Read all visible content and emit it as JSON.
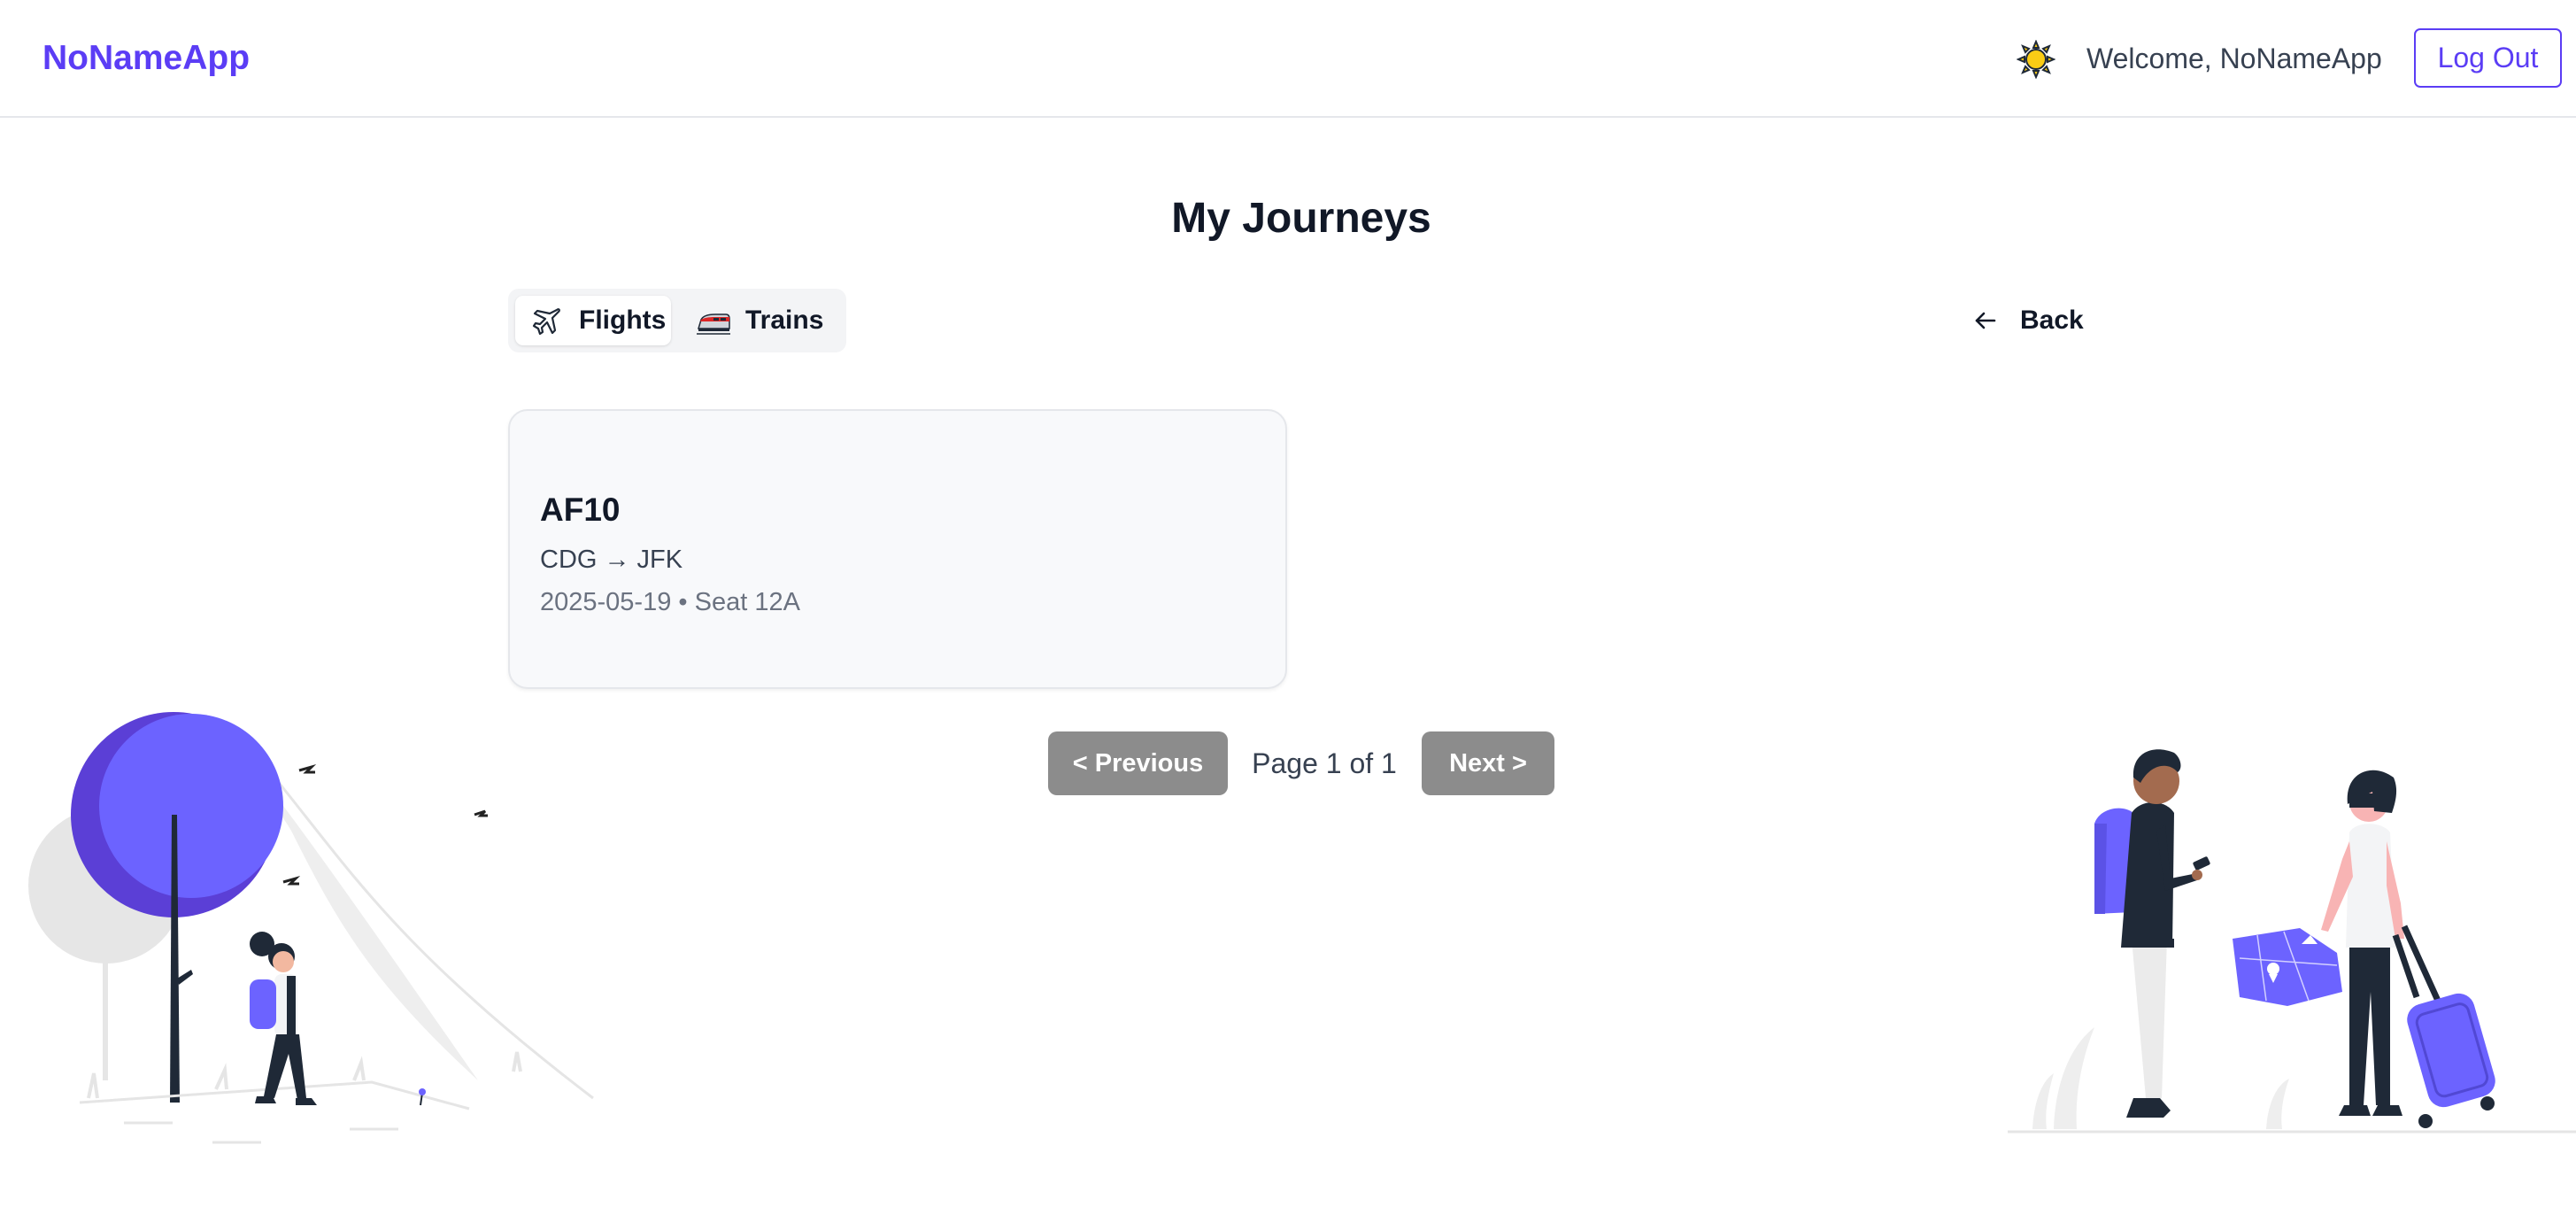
{
  "header": {
    "brand": "NoNameApp",
    "welcome": "Welcome, NoNameApp",
    "logout_label": "Log Out",
    "theme_icon": "sun-icon"
  },
  "page": {
    "title": "My Journeys",
    "back_label": "Back"
  },
  "tabs": [
    {
      "label": "Flights",
      "icon": "airplane-icon",
      "active": true
    },
    {
      "label": "Trains",
      "icon": "train-icon",
      "active": false
    }
  ],
  "journeys": [
    {
      "code": "AF10",
      "route": "CDG → JFK",
      "meta": "2025-05-19 • Seat 12A"
    }
  ],
  "pagination": {
    "prev_label": "< Previous",
    "info": "Page 1 of 1",
    "next_label": "Next >"
  },
  "colors": {
    "accent": "#5b3df5",
    "illustration": "#6c63ff",
    "disabled_button": "#8c8c8c"
  }
}
